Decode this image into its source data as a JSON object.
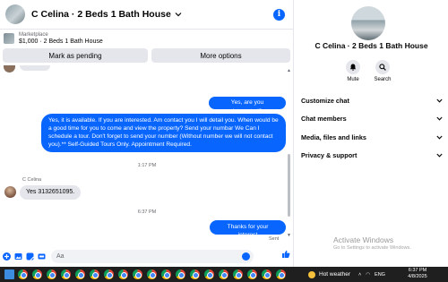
{
  "header": {
    "title": "C Celina · 2 Beds 1 Bath House"
  },
  "listing": {
    "source": "Marketplace",
    "item": "$1,000 · 2 Beds 1 Bath House"
  },
  "actions": {
    "mark_pending": "Mark as pending",
    "more_options": "More options"
  },
  "messages": {
    "outgoing_1": "Yes, are you interested?",
    "outgoing_2": "Yes, it is available. If you are interested.  Am contact you I will detail you.  When would be a good time for you to come and view the property? Send your numbar We Can I schedule a tour.  Don't forget to send your number (Without number we will not contact you).** Self-Guided Tours Only. Appointment Required.",
    "time_1": "1:17 PM",
    "sender_name": "C Celina",
    "incoming_1": "Yes 3132651095.",
    "time_2": "6:37 PM",
    "outgoing_3": "Thanks for your interest",
    "sent_status": "Sent"
  },
  "composer": {
    "placeholder": "Aa"
  },
  "info_panel": {
    "title": "C Celina · 2 Beds 1 Bath House",
    "mute_label": "Mute",
    "search_label": "Search",
    "menu": [
      "Customize chat",
      "Chat members",
      "Media, files and links",
      "Privacy & support"
    ]
  },
  "windows": {
    "activate_title": "Activate Windows",
    "activate_sub": "Go to Settings to activate Windows."
  },
  "taskbar": {
    "weather": "Hot weather",
    "language": "ENG",
    "time": "6:37 PM",
    "date": "4/8/2025"
  },
  "colors": {
    "accent": "#0866ff",
    "bubble_in": "#e4e6eb",
    "taskbar": "#1f1f1f"
  },
  "icons": [
    "info-icon",
    "mute-bell-icon",
    "search-icon",
    "plus-icon",
    "sticker-icon",
    "gallery-icon",
    "gif-icon",
    "emoji-icon",
    "thumbs-up-icon",
    "chevron-down-icon"
  ]
}
